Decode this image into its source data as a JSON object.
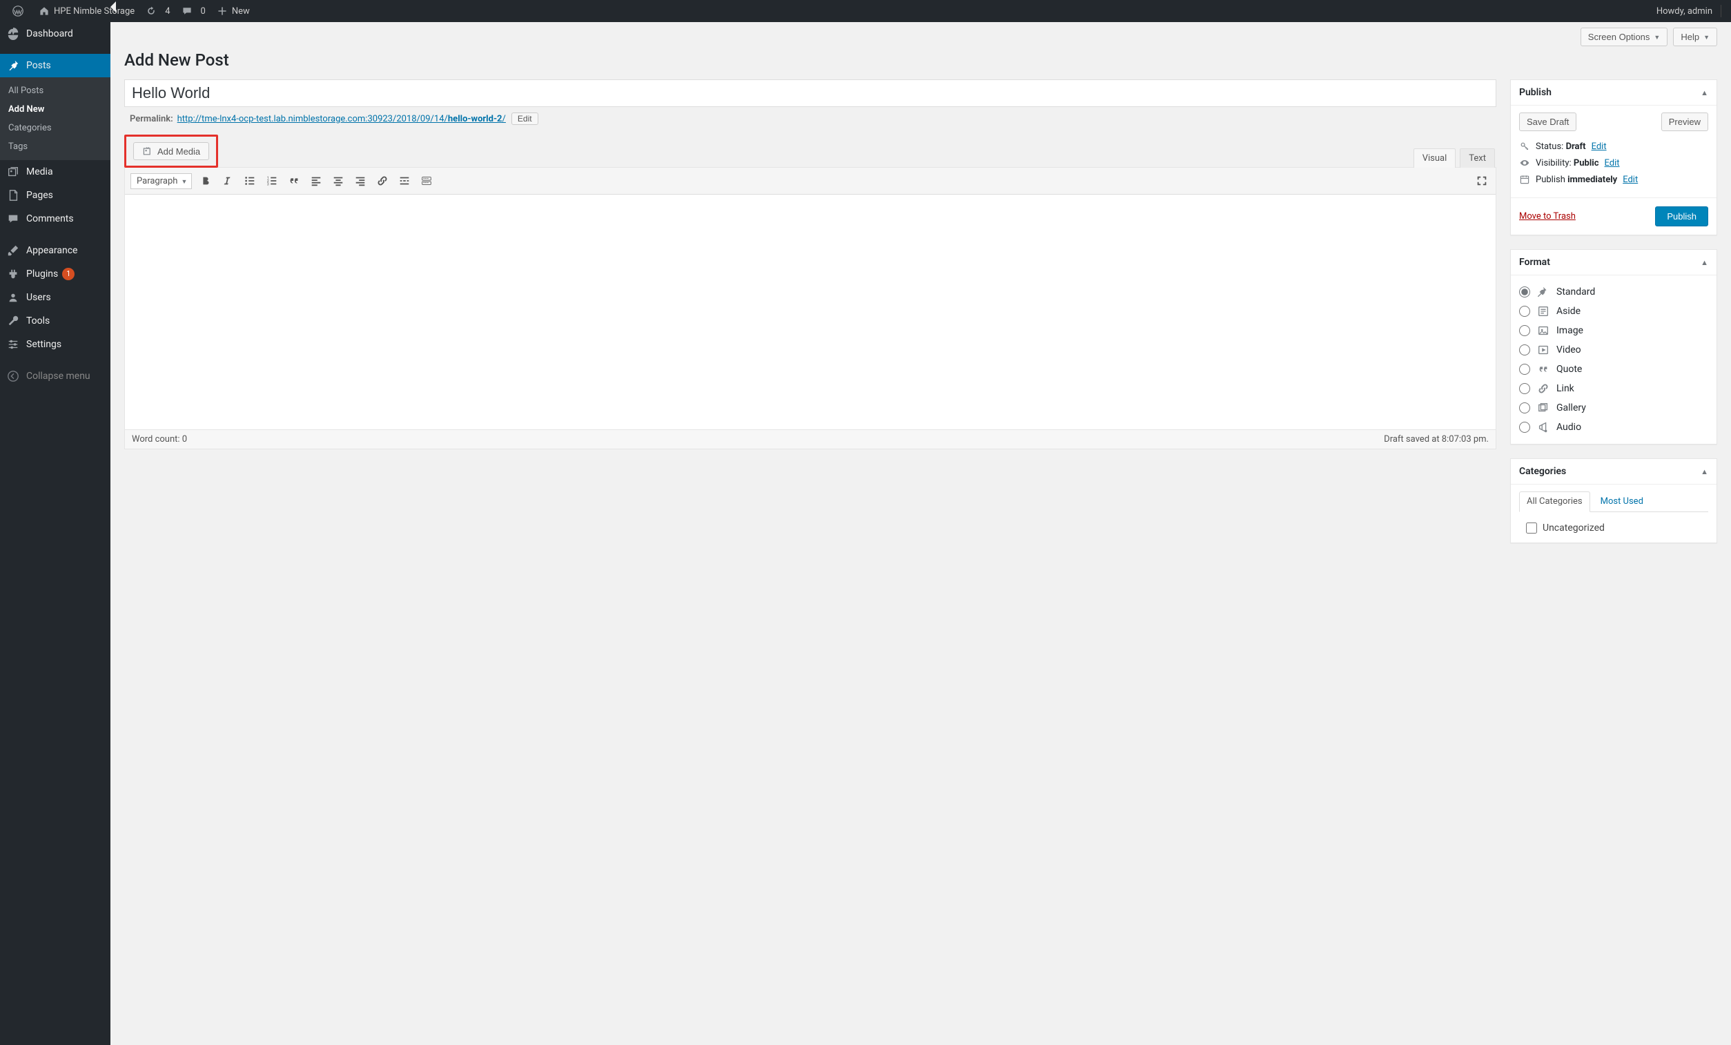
{
  "adminbar": {
    "site_title": "HPE Nimble Storage",
    "update_count": "4",
    "comment_count": "0",
    "new_label": "New",
    "howdy": "Howdy, admin"
  },
  "top": {
    "screen_options": "Screen Options",
    "help": "Help"
  },
  "page_title": "Add New Post",
  "sidebar": {
    "dashboard": "Dashboard",
    "posts": "Posts",
    "posts_sub": [
      "All Posts",
      "Add New",
      "Categories",
      "Tags"
    ],
    "media": "Media",
    "pages": "Pages",
    "comments": "Comments",
    "appearance": "Appearance",
    "plugins": "Plugins",
    "plugins_badge": "1",
    "users": "Users",
    "tools": "Tools",
    "settings": "Settings",
    "collapse": "Collapse menu"
  },
  "post": {
    "title": "Hello World",
    "permalink_label": "Permalink:",
    "permalink_base": "http://tme-lnx4-ocp-test.lab.nimblestorage.com:30923/2018/09/14/",
    "permalink_slug": "hello-world-2",
    "edit_btn": "Edit",
    "add_media": "Add Media",
    "tabs": {
      "visual": "Visual",
      "text": "Text"
    },
    "paragraph_sel": "Paragraph",
    "word_count_label": "Word count: ",
    "word_count": "0",
    "draft_saved": "Draft saved at 8:07:03 pm."
  },
  "publish": {
    "title": "Publish",
    "save_draft": "Save Draft",
    "preview": "Preview",
    "status_label": "Status:",
    "status_value": "Draft",
    "visibility_label": "Visibility:",
    "visibility_value": "Public",
    "publish_when_label": "Publish",
    "publish_when_value": "immediately",
    "edit_link": "Edit",
    "trash": "Move to Trash",
    "publish_btn": "Publish"
  },
  "format": {
    "title": "Format",
    "options": [
      "Standard",
      "Aside",
      "Image",
      "Video",
      "Quote",
      "Link",
      "Gallery",
      "Audio"
    ],
    "selected": "Standard"
  },
  "categories": {
    "title": "Categories",
    "tab_all": "All Categories",
    "tab_most": "Most Used",
    "items": [
      "Uncategorized"
    ]
  }
}
